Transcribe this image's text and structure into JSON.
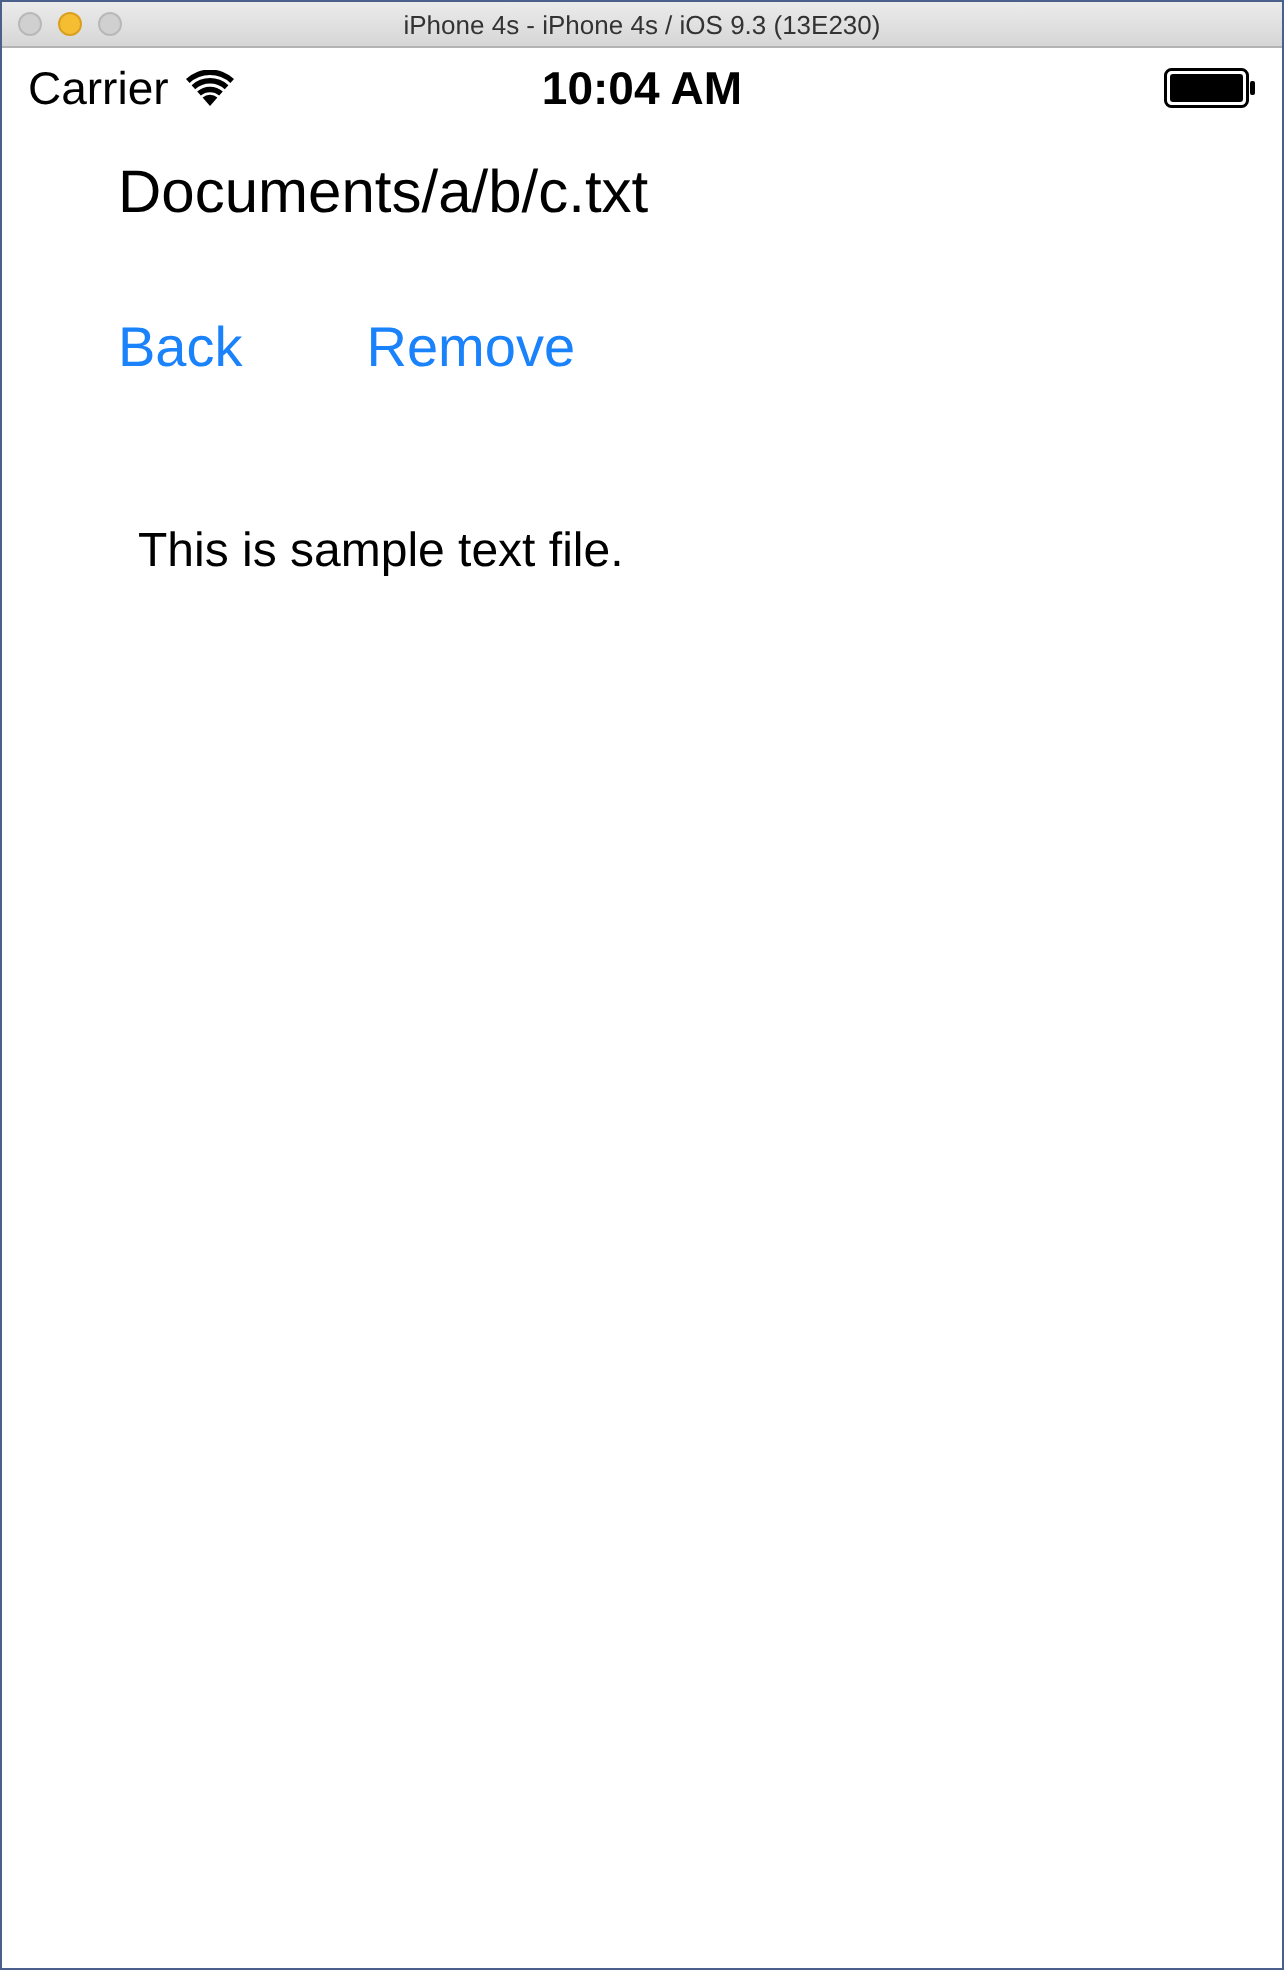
{
  "window": {
    "title": "iPhone 4s - iPhone 4s / iOS 9.3 (13E230)"
  },
  "status_bar": {
    "carrier": "Carrier",
    "time": "10:04 AM"
  },
  "path_title": "Documents/a/b/c.txt",
  "buttons": [
    {
      "label": "Back"
    },
    {
      "label": "Remove"
    }
  ],
  "content": "This is sample text file."
}
